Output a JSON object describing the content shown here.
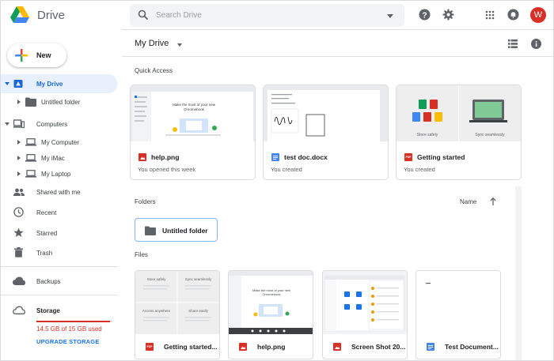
{
  "header": {
    "brand": "Drive",
    "search_placeholder": "Search Drive",
    "avatar_letter": "W"
  },
  "sidebar": {
    "new_label": "New",
    "items": [
      {
        "label": "My Drive"
      },
      {
        "label": "Untitled folder"
      },
      {
        "label": "Computers"
      },
      {
        "label": "My Computer"
      },
      {
        "label": "My iMac"
      },
      {
        "label": "My Laptop"
      },
      {
        "label": "Shared with me"
      },
      {
        "label": "Recent"
      },
      {
        "label": "Starred"
      },
      {
        "label": "Trash"
      },
      {
        "label": "Backups"
      },
      {
        "label": "Storage"
      }
    ],
    "storage_used": "14.5 GB of 15 GB used",
    "storage_fraction": 0.967,
    "upgrade_label": "UPGRADE STORAGE"
  },
  "main": {
    "title": "My Drive",
    "quick_access_label": "Quick Access",
    "quick_access": [
      {
        "name": "help.png",
        "subtitle": "You opened this week",
        "icon": "image-file-icon"
      },
      {
        "name": "test doc.docx",
        "subtitle": "You created",
        "icon": "docs-file-icon"
      },
      {
        "name": "Getting started",
        "subtitle": "You created",
        "icon": "pdf-file-icon"
      }
    ],
    "folders_label": "Folders",
    "sort_label": "Name",
    "folders": [
      {
        "name": "Untitled folder"
      }
    ],
    "files_label": "Files",
    "files": [
      {
        "name": "Getting started...",
        "icon": "pdf-file-icon"
      },
      {
        "name": "help.png",
        "icon": "image-file-icon"
      },
      {
        "name": "Screen Shot 20...",
        "icon": "image-file-icon"
      },
      {
        "name": "Test Document...",
        "icon": "docs-file-icon"
      }
    ],
    "thumb_text": {
      "chromebook": "Make the most of your new Chromebook",
      "getting_started_1": "Store safely",
      "getting_started_2": "Sync seamlessly",
      "getting_started_3": "Access anywhere",
      "getting_started_4": "Share easily",
      "pdf_badge": "PDF"
    }
  },
  "colors": {
    "accent": "#1a73e8",
    "active_bg": "#e8f0fe",
    "image_red": "#d93025",
    "docs_blue": "#4285f4",
    "storage_red": "#d93025"
  }
}
